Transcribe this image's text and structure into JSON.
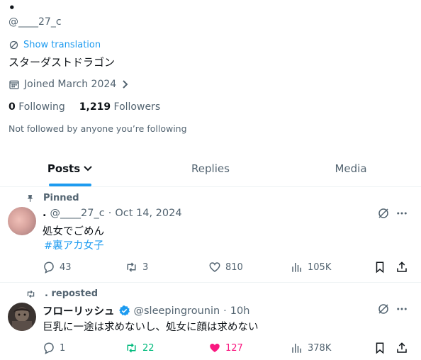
{
  "profile": {
    "display_name": "•",
    "handle": "@____27_c",
    "show_translation": "Show translation",
    "bio": "スターダストドラゴン",
    "joined": "Joined March 2024",
    "following_count": "0",
    "following_label": "Following",
    "followers_count": "1,219",
    "followers_label": "Followers",
    "not_followed": "Not followed by anyone you’re following"
  },
  "tabs": [
    {
      "label": "Posts"
    },
    {
      "label": "Replies"
    },
    {
      "label": "Media"
    }
  ],
  "posts": [
    {
      "social": "Pinned",
      "name": ".",
      "handle": "@____27_c",
      "sep": "·",
      "time": "Oct 14, 2024",
      "text": "処女でごめん",
      "hashtag": "#裏アカ女子",
      "replies": "43",
      "reposts": "3",
      "likes": "810",
      "views": "105K"
    },
    {
      "social": ". reposted",
      "name": "フローリッシュ",
      "handle": "@sleepingrounin",
      "sep": "·",
      "time": "10h",
      "text": "巨乳に一途は求めないし、処女に顔は求めない",
      "replies": "1",
      "reposts": "22",
      "likes": "127",
      "views": "378K"
    }
  ],
  "colors": {
    "accent": "#1d9bf0",
    "repost_active": "#00ba7c",
    "like_active": "#f91880",
    "muted": "#536471"
  }
}
